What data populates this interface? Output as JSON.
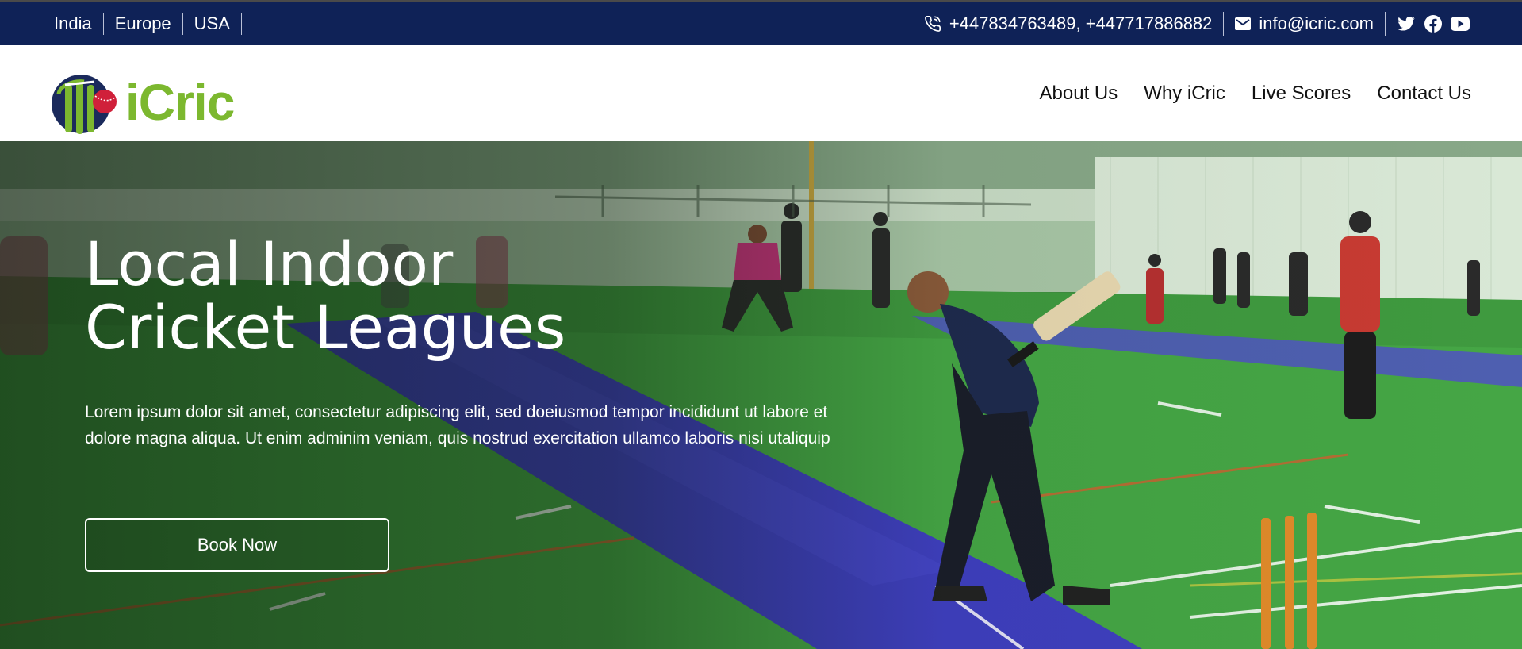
{
  "topbar": {
    "regions": [
      "India",
      "Europe",
      "USA"
    ],
    "phone": "+447834763489, +447717886882",
    "email": "info@icric.com",
    "icons": {
      "phone": "phone-icon",
      "email": "mail-icon",
      "social": [
        "twitter-icon",
        "facebook-icon",
        "youtube-icon"
      ]
    }
  },
  "navbar": {
    "logo_text": "iCric",
    "links": [
      "About Us",
      "Why iCric",
      "Live Scores",
      "Contact Us"
    ]
  },
  "hero": {
    "title_line1": "Local Indoor",
    "title_line2": "Cricket Leagues",
    "description": "Lorem ipsum dolor sit amet, consectetur adipiscing elit, sed doeiusmod tempor incididunt ut labore et dolore magna aliqua. Ut enim adminim veniam, quis nostrud exercitation ullamco laboris nisi utaliquip",
    "button_label": "Book Now"
  },
  "colors": {
    "topbar_bg": "#0f2257",
    "brand_green": "#7cb82f",
    "brand_navy": "#1b2a5c",
    "ball_red": "#d0203a"
  }
}
